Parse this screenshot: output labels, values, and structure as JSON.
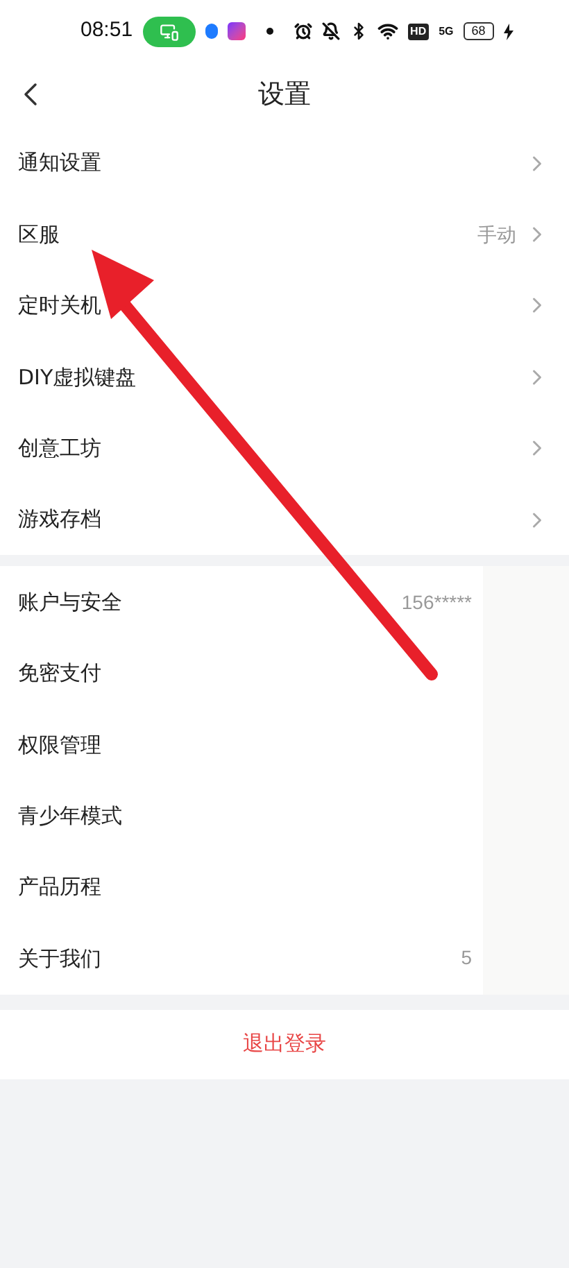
{
  "status_bar": {
    "time": "08:51",
    "hd": "HD",
    "network": "5G",
    "battery": "68"
  },
  "header": {
    "title": "设置"
  },
  "sections": [
    {
      "chevron": true,
      "items": [
        {
          "label": "通知设置"
        },
        {
          "label": "区服",
          "value": "手动"
        },
        {
          "label": "定时关机"
        },
        {
          "label": "DIY虚拟键盘"
        },
        {
          "label": "创意工坊"
        },
        {
          "label": "游戏存档"
        }
      ]
    },
    {
      "chevron": false,
      "items": [
        {
          "label": "账户与安全",
          "value": "156*****"
        },
        {
          "label": "免密支付"
        },
        {
          "label": "权限管理"
        },
        {
          "label": "青少年模式"
        },
        {
          "label": "产品历程"
        },
        {
          "label": "关于我们",
          "value": "5"
        }
      ]
    }
  ],
  "logout": "退出登录"
}
